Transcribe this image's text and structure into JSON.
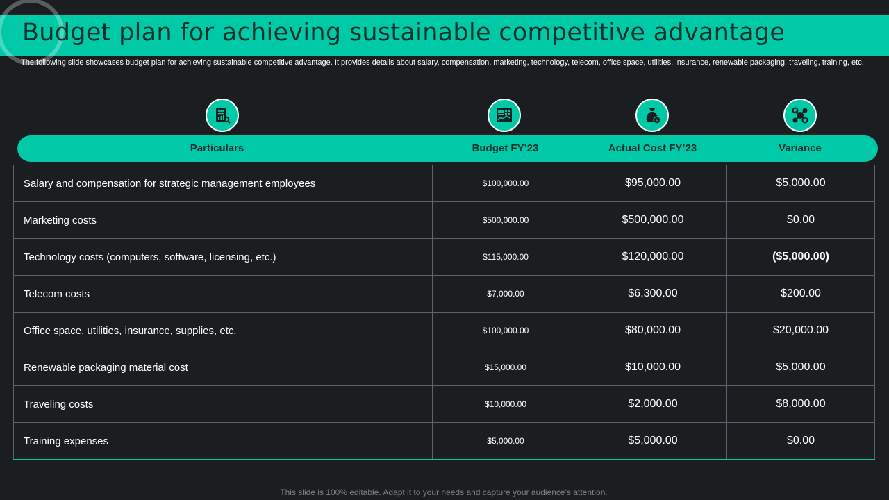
{
  "title": "Budget plan for achieving sustainable competitive advantage",
  "subtitle": "The following slide showcases budget plan for achieving sustainable competitive advantage. It provides details about salary, compensation, marketing, technology, telecom, office space, utilities, insurance, renewable packaging, traveling, training, etc.",
  "columns": {
    "particulars": "Particulars",
    "budget": "Budget FY’23",
    "actual": "Actual Cost FY’23",
    "variance": "Variance"
  },
  "icons": {
    "particulars": "report-document-icon",
    "budget": "calculator-spreadsheet-icon",
    "actual": "money-bag-icon",
    "variance": "molecule-network-icon"
  },
  "rows": [
    {
      "particular": "Salary and compensation for strategic management employees",
      "budget": "$100,000.00",
      "actual": "$95,000.00",
      "variance": "$5,000.00"
    },
    {
      "particular": "Marketing costs",
      "budget": "$500,000.00",
      "actual": "$500,000.00",
      "variance": "$0.00"
    },
    {
      "particular": "Technology costs (computers, software, licensing, etc.)",
      "budget": "$115,000.00",
      "actual": "$120,000.00",
      "variance": "($5,000.00)"
    },
    {
      "particular": "Telecom costs",
      "budget": "$7,000.00",
      "actual": "$6,300.00",
      "variance": "$200.00"
    },
    {
      "particular": "Office space, utilities, insurance, supplies, etc.",
      "budget": "$100,000.00",
      "actual": "$80,000.00",
      "variance": "$20,000.00"
    },
    {
      "particular": "Renewable packaging material cost",
      "budget": "$15,000.00",
      "actual": "$10,000.00",
      "variance": "$5,000.00"
    },
    {
      "particular": "Traveling costs",
      "budget": "$10,000.00",
      "actual": "$2,000.00",
      "variance": "$8,000.00"
    },
    {
      "particular": "Training expenses",
      "budget": "$5,000.00",
      "actual": "$5,000.00",
      "variance": "$0.00"
    }
  ],
  "footer": "This slide is 100% editable. Adapt it to your needs and capture your audience’s attention.",
  "colors": {
    "accent": "#00c9a7",
    "background": "#1b1e20",
    "title_text": "#10302a",
    "grid": "#5e6469"
  }
}
